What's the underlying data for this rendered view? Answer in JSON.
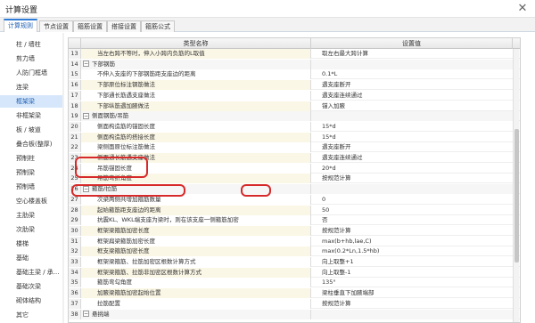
{
  "window": {
    "title": "计算设置",
    "close_glyph": "✕"
  },
  "tabs": [
    "计算规则",
    "节点设置",
    "箍筋设置",
    "搭接设置",
    "箍筋公式"
  ],
  "active_tab": 0,
  "sidebar": {
    "items": [
      "柱 / 墙柱",
      "剪力墙",
      "人防门框墙",
      "连梁",
      "框架梁",
      "非框架梁",
      "板 / 坡道",
      "叠合板(整厚)",
      "预制柱",
      "预制梁",
      "预制墙",
      "空心楼盖板",
      "主肋梁",
      "次肋梁",
      "楼梯",
      "基础",
      "基础主梁 / 承...",
      "基础次梁",
      "砌体结构",
      "其它"
    ],
    "selected": 4
  },
  "grid": {
    "columns": [
      "类型名称",
      "设置值"
    ],
    "rows": [
      {
        "num": "13",
        "name": "当左右跨不等时，伸入小跨内负筋的L取值",
        "value": "取左右最大跨计算",
        "indent": 2,
        "alt": true
      },
      {
        "num": "14",
        "name": "下部钢筋",
        "value": "",
        "indent": 0,
        "group": true
      },
      {
        "num": "15",
        "name": "不伸入支座的下部钢筋距支座边的距离",
        "value": "0.1*L",
        "indent": 2
      },
      {
        "num": "16",
        "name": "下部原位标注钢筋做法",
        "value": "遇支座断开",
        "indent": 2,
        "alt": true
      },
      {
        "num": "17",
        "name": "下部通长筋遇支座做法",
        "value": "遇支座连续通过",
        "indent": 2
      },
      {
        "num": "18",
        "name": "下部纵筋遇加腋做法",
        "value": "锚入加腋",
        "indent": 2,
        "alt": true
      },
      {
        "num": "19",
        "name": "侧面钢筋/吊筋",
        "value": "",
        "indent": 0,
        "group": true
      },
      {
        "num": "20",
        "name": "侧面构造筋的锚固长度",
        "value": "15*d",
        "indent": 2
      },
      {
        "num": "21",
        "name": "侧面构造筋的搭接长度",
        "value": "15*d",
        "indent": 2,
        "alt": true
      },
      {
        "num": "22",
        "name": "梁侧面原位标注筋做法",
        "value": "遇支座断开",
        "indent": 2
      },
      {
        "num": "23",
        "name": "侧面通长筋遇支座做法",
        "value": "遇支座连续通过",
        "indent": 2,
        "alt": true
      },
      {
        "num": "24",
        "name": "吊筋锚固长度",
        "value": "20*d",
        "indent": 2
      },
      {
        "num": "25",
        "name": "吊筋弯折角度",
        "value": "按规范计算",
        "indent": 2,
        "alt": true
      },
      {
        "num": "26",
        "name": "箍筋/拉筋",
        "value": "",
        "indent": 0,
        "group": true
      },
      {
        "num": "27",
        "name": "次梁两侧共增加箍筋数量",
        "value": "0",
        "indent": 2
      },
      {
        "num": "28",
        "name": "起始箍筋距支座边的距离",
        "value": "50",
        "indent": 2,
        "alt": true
      },
      {
        "num": "29",
        "name": "抗震KL、WKL端支座为梁时，则在该支座一侧箍筋加密",
        "value": "否",
        "indent": 2
      },
      {
        "num": "30",
        "name": "框架梁箍筋加密长度",
        "value": "按规范计算",
        "indent": 2,
        "alt": true
      },
      {
        "num": "31",
        "name": "框架扁梁箍筋加密长度",
        "value": "max(b+hb,lae,C)",
        "indent": 2
      },
      {
        "num": "32",
        "name": "框支梁箍筋加密长度",
        "value": "max(0.2*Ln,1.5*hb)",
        "indent": 2,
        "alt": true
      },
      {
        "num": "33",
        "name": "框架梁箍筋、拉筋加密区根数计算方式",
        "value": "向上取整+1",
        "indent": 2
      },
      {
        "num": "34",
        "name": "框架梁箍筋、拉筋非加密区根数计算方式",
        "value": "向上取整-1",
        "indent": 2,
        "alt": true
      },
      {
        "num": "35",
        "name": "箍筋弯勾角度",
        "value": "135°",
        "indent": 2
      },
      {
        "num": "36",
        "name": "加腋梁箍筋加密起始位置",
        "value": "梁柱垂直下加腋端部",
        "indent": 2,
        "alt": true
      },
      {
        "num": "37",
        "name": "拉筋配置",
        "value": "按规范计算",
        "indent": 2
      },
      {
        "num": "38",
        "name": "悬挑端",
        "value": "",
        "indent": 0,
        "group": true
      }
    ]
  }
}
